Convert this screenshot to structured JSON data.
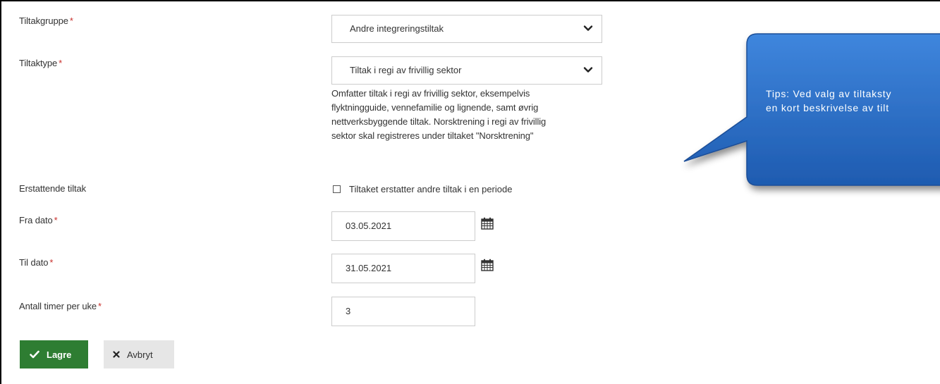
{
  "form": {
    "tiltakgruppe": {
      "label": "Tiltakgruppe",
      "required_mark": "*",
      "value": "Andre integreringstiltak"
    },
    "tiltaktype": {
      "label": "Tiltaktype",
      "required_mark": "*",
      "value": "Tiltak i regi av frivillig sektor",
      "help_lines": [
        "Omfatter tiltak i regi av frivillig sektor, eksempelvis",
        "flyktningguide, vennefamilie og lignende, samt øvrig",
        "nettverksbyggende tiltak. Norsktrening i regi av frivillig",
        "sektor skal registreres under tiltaket \"Norsktrening\""
      ]
    },
    "erstattende": {
      "label": "Erstattende tiltak",
      "checkbox_label": "Tiltaket erstatter andre tiltak i en periode",
      "checked": false
    },
    "fra_dato": {
      "label": "Fra dato",
      "required_mark": "*",
      "value": "03.05.2021"
    },
    "til_dato": {
      "label": "Til dato",
      "required_mark": "*",
      "value": "31.05.2021"
    },
    "timer": {
      "label": "Antall timer per uke",
      "required_mark": "*",
      "value": "3"
    }
  },
  "buttons": {
    "save_label": "Lagre",
    "cancel_label": "Avbryt"
  },
  "callout": {
    "lines": [
      "Tips: Ved valg av tiltaksty",
      "en kort beskrivelse av tilt"
    ]
  },
  "icons": {
    "chevron": "chevron-down-icon",
    "calendar": "calendar-icon",
    "check": "check-icon",
    "close": "close-icon"
  },
  "colors": {
    "save_button": "#2e7d32",
    "cancel_button": "#e6e6e6",
    "required": "#c9302c",
    "callout_fill": "#2b6fc8"
  }
}
